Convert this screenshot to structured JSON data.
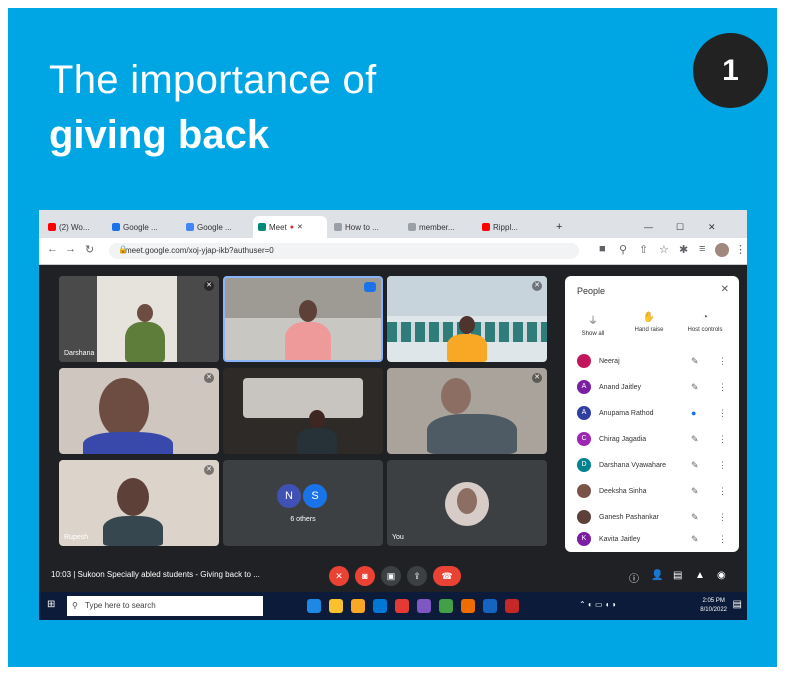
{
  "card": {
    "title_line1": "The importance of",
    "title_line2": "giving back",
    "number": "1",
    "background_color": "#00a5e3"
  },
  "browser": {
    "tabs": [
      {
        "label": "(2) Wo...",
        "favicon": "youtube-icon",
        "color": "#ff0000"
      },
      {
        "label": "Google ...",
        "favicon": "drive-icon",
        "color": "#1a73e8"
      },
      {
        "label": "Google ...",
        "favicon": "docs-icon",
        "color": "#4285f4"
      },
      {
        "label": "Meet",
        "favicon": "meet-icon",
        "color": "#00897b",
        "active": true
      },
      {
        "label": "How to ...",
        "favicon": "search-icon",
        "color": "#5f6368"
      },
      {
        "label": "member...",
        "favicon": "search-icon",
        "color": "#5f6368"
      },
      {
        "label": "Rippl...",
        "favicon": "youtube-icon",
        "color": "#ff0000"
      }
    ],
    "url": "meet.google.com/xoj-yjap-ikb?authuser=0"
  },
  "meeting": {
    "tiles": [
      {
        "name": "Darshana"
      },
      {
        "name": ""
      },
      {
        "name": ""
      },
      {
        "name": ""
      },
      {
        "name": ""
      },
      {
        "name": ""
      },
      {
        "name": "Rupesh"
      },
      {
        "name": "6 others",
        "avatars": [
          "N",
          "S"
        ]
      },
      {
        "name": "You"
      }
    ],
    "others_initials": [
      "N",
      "S"
    ],
    "others_label": "6 others",
    "self_label": "You"
  },
  "people_panel": {
    "title": "People",
    "actions": [
      {
        "label": "Show all",
        "icon": "mic-icon"
      },
      {
        "label": "Hand raise",
        "icon": "hand-icon"
      },
      {
        "label": "Host controls",
        "icon": "shield-icon"
      }
    ],
    "participants": [
      {
        "name": "Neeraj",
        "color": "#c2185b",
        "initial": ""
      },
      {
        "name": "Anand Jaitley",
        "color": "#7b1fa2",
        "initial": "A"
      },
      {
        "name": "Anupama Rathod",
        "color": "#303f9f",
        "initial": "A"
      },
      {
        "name": "Chirag Jagadia",
        "color": "#9c27b0",
        "initial": "C"
      },
      {
        "name": "Darshana Vyawahare",
        "color": "#00838f",
        "initial": "D"
      },
      {
        "name": "Deeksha Sinha",
        "color": "#795548",
        "initial": ""
      },
      {
        "name": "Ganesh Pashankar",
        "color": "#5d4037",
        "initial": ""
      },
      {
        "name": "Kavita Jaitley",
        "color": "#7b1fa2",
        "initial": "K"
      }
    ]
  },
  "control_bar": {
    "meeting_text": "10:03  |  Sukoon Specially abled students - Giving back to ..."
  },
  "taskbar": {
    "search_placeholder": "Type here to search",
    "time": "2:05 PM",
    "date": "8/10/2022"
  }
}
